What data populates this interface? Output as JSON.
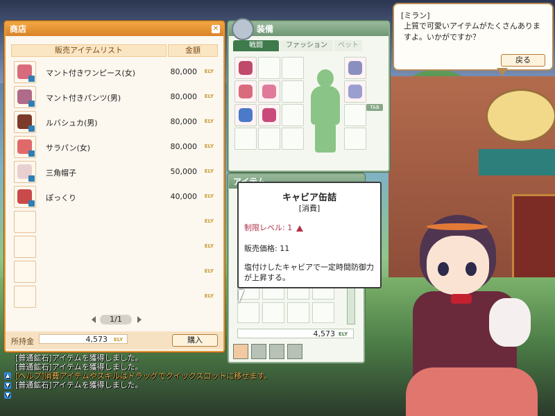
{
  "shop": {
    "title": "商店",
    "col_items": "販売アイテムリスト",
    "col_price": "金額",
    "currency": "ELY",
    "items": [
      {
        "name": "マント付きワンピース(女)",
        "price": "80,000",
        "color": "#d86c7c"
      },
      {
        "name": "マント付きパンツ(男)",
        "price": "80,000",
        "color": "#b06a8a"
      },
      {
        "name": "ルバシュカ(男)",
        "price": "80,000",
        "color": "#7b3a2a"
      },
      {
        "name": "サラパン(女)",
        "price": "80,000",
        "color": "#e06a6a"
      },
      {
        "name": "三角帽子",
        "price": "50,000",
        "color": "#d9b2b2"
      },
      {
        "name": "ぽっくり",
        "price": "40,000",
        "color": "#c84a4a"
      }
    ],
    "page": "1/1",
    "money_label": "所持金",
    "money": "4,573",
    "buy_label": "購入"
  },
  "equip": {
    "title": "装備",
    "tabs": [
      "戦闘",
      "ファッション",
      "ペット"
    ],
    "tab_button": "TAB"
  },
  "item_window": {
    "title": "アイテム",
    "money": "4,573",
    "currency": "ELY"
  },
  "tooltip": {
    "name": "キャビア缶詰",
    "category": "[消費]",
    "level": "制限レベル: 1",
    "price": "販売価格: 11",
    "desc": "塩付けしたキャビアで一定時間防御力が上昇する。"
  },
  "npc": {
    "speaker": "[ミラン]",
    "message": "上質で可愛いアイテムがたくさんありますよ。いかがですか？",
    "back": "戻る"
  },
  "chat": [
    {
      "text": "[普通鉱石]アイテムを獲得しました。",
      "type": "normal"
    },
    {
      "text": "[普通鉱石]アイテムを獲得しました。",
      "type": "normal"
    },
    {
      "text": "[ヘルプ]消費アイテムやスキルはドラッグでクイックスロットに移せます。",
      "type": "help"
    },
    {
      "text": "[普通鉱石]アイテムを獲得しました。",
      "type": "normal"
    }
  ]
}
